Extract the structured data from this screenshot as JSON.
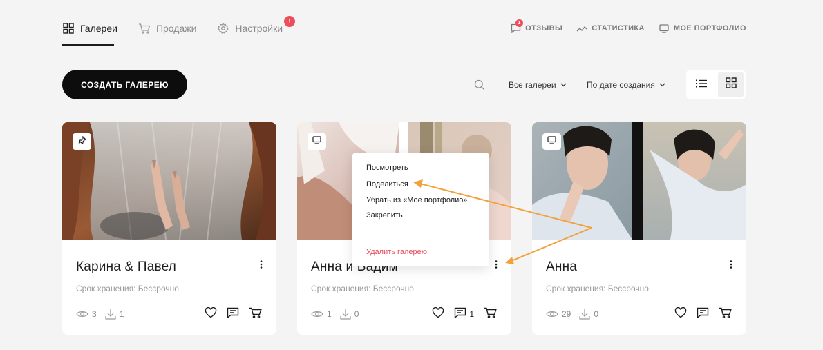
{
  "nav": {
    "items": [
      {
        "label": "Галереи",
        "icon": "grid-icon",
        "active": true
      },
      {
        "label": "Продажи",
        "icon": "cart-icon",
        "active": false
      },
      {
        "label": "Настройки",
        "icon": "gear-icon",
        "active": false
      }
    ],
    "settings_badge": "!"
  },
  "right_nav": {
    "reviews": {
      "label": "ОТЗЫВЫ",
      "badge": "1"
    },
    "stats": {
      "label": "СТАТИСТИКА"
    },
    "portfolio": {
      "label": "МОЕ ПОРТФОЛИО"
    }
  },
  "toolbar": {
    "create_label": "СОЗДАТЬ ГАЛЕРЕЮ",
    "filter_label": "Все галереи",
    "sort_label": "По дате создания"
  },
  "cards": [
    {
      "title": "Карина & Павел",
      "subtitle": "Срок хранения: Бессрочно",
      "views": "3",
      "downloads": "1",
      "comments": "",
      "badge_icon": "pin-icon"
    },
    {
      "title": "Анна и Вадим",
      "subtitle": "Срок хранения: Бессрочно",
      "views": "1",
      "downloads": "0",
      "comments": "1",
      "badge_icon": "monitor-icon"
    },
    {
      "title": "Анна",
      "subtitle": "Срок хранения: Бессрочно",
      "views": "29",
      "downloads": "0",
      "comments": "",
      "badge_icon": "monitor-icon"
    }
  ],
  "context_menu": {
    "view": "Посмотреть",
    "share": "Поделиться",
    "remove_portfolio": "Убрать из «Мое портфолио»",
    "pin": "Закрепить",
    "delete": "Удалить галерею"
  },
  "colors": {
    "accent_red": "#ee4d5c",
    "annotation_arrow": "#f2a23a",
    "button_dark": "#0d0d0d"
  }
}
